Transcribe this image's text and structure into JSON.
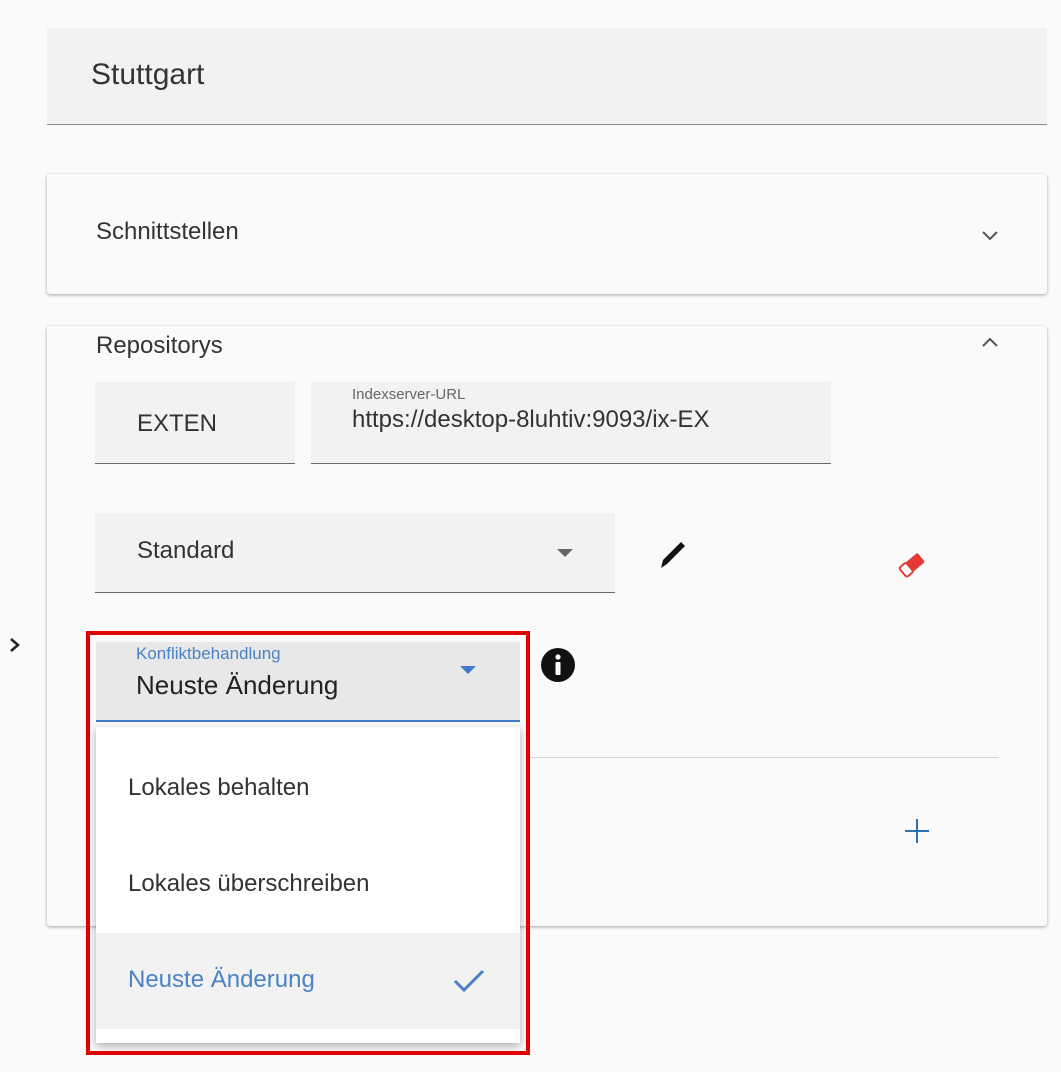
{
  "header": {
    "title": "Stuttgart"
  },
  "panels": {
    "interfaces": {
      "label": "Schnittstellen"
    },
    "repositories": {
      "label": "Repositorys"
    }
  },
  "repository": {
    "name_value": "EXTEN",
    "url_label": "Indexserver-URL",
    "url_value": "https://desktop-8luhtiv:9093/ix-EX",
    "profile_value": "Standard"
  },
  "conflict": {
    "label": "Konfliktbehandlung",
    "value": "Neuste Änderung",
    "options": [
      {
        "label": "Lokales behalten",
        "selected": false
      },
      {
        "label": "Lokales überschreiben",
        "selected": false
      },
      {
        "label": "Neuste Änderung",
        "selected": true
      }
    ]
  },
  "colors": {
    "accent": "#3d7bc7",
    "highlight": "#e00000",
    "eraser": "#e53935"
  }
}
